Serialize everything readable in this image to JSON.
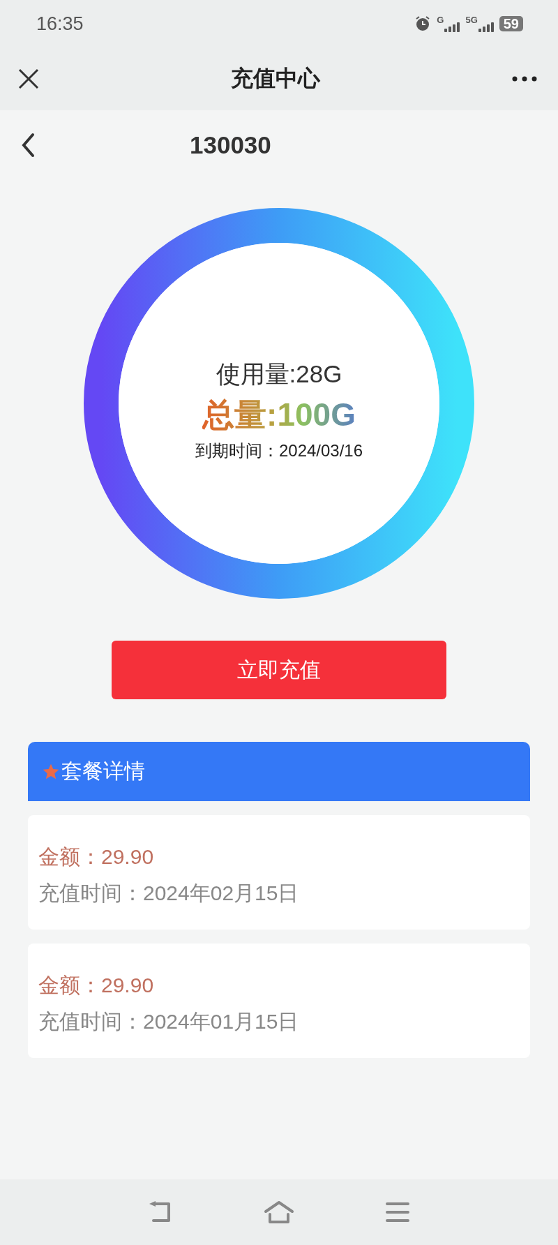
{
  "status_bar": {
    "time": "16:35",
    "network_1": "G",
    "network_2": "5G",
    "battery": "59"
  },
  "header": {
    "title": "充值中心"
  },
  "account": {
    "number": "130030"
  },
  "usage": {
    "used": "使用量:28G",
    "total": "总量:100G",
    "expiry": "到期时间：2024/03/16"
  },
  "recharge_button": "立即充值",
  "details": {
    "title": "套餐详情",
    "records": [
      {
        "amount": "金额：29.90",
        "time": "充值时间：2024年02月15日"
      },
      {
        "amount": "金额：29.90",
        "time": "充值时间：2024年01月15日"
      }
    ]
  }
}
